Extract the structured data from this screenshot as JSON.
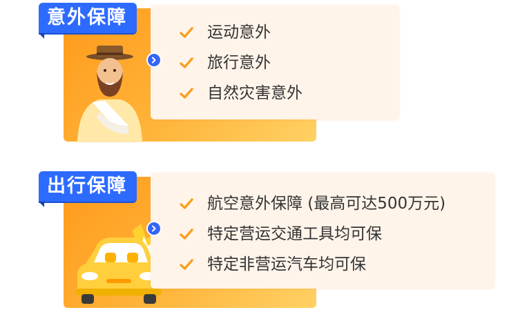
{
  "sections": [
    {
      "title": "意外保障",
      "items": [
        "运动意外",
        "旅行意外",
        "自然灾害意外"
      ]
    },
    {
      "title": "出行保障",
      "items": [
        "航空意外保障 (最高可达500万元)",
        "特定营运交通工具均可保",
        "特定非营运汽车均可保"
      ]
    }
  ],
  "colors": {
    "tab": "#2d6bff",
    "orange": "#ff9a1a",
    "cream": "#fff4ea",
    "check": "#f7a021",
    "text": "#333333"
  },
  "icons": {
    "check": "check-icon",
    "arrow": "chevron-right-icon",
    "person": "injured-man-illustration",
    "car": "crashed-car-illustration"
  }
}
